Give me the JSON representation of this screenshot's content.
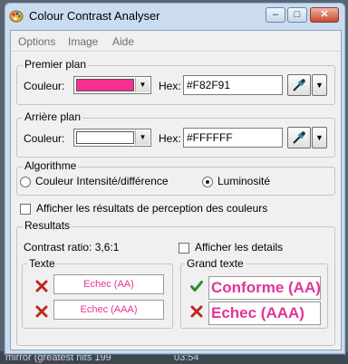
{
  "window": {
    "title": "Colour Contrast Analyser"
  },
  "titlebar_buttons": {
    "minimize": "–",
    "maximize": "□",
    "close": "✕"
  },
  "menu": [
    "Options",
    "Image",
    "Aide"
  ],
  "foreground": {
    "legend": "Premier plan",
    "color_label": "Couleur:",
    "hex_label": "Hex:",
    "hex_value": "#F82F91",
    "swatch_color": "#F82F91"
  },
  "background": {
    "legend": "Arrière plan",
    "color_label": "Couleur:",
    "hex_label": "Hex:",
    "hex_value": "#FFFFFF",
    "swatch_color": "#FFFFFF"
  },
  "algorithm": {
    "legend": "Algorithme",
    "option1": "Couleur Intensité/différence",
    "option2": "Luminosité",
    "selected": "Luminosité"
  },
  "perception_checkbox": "Afficher les résultats de perception des couleurs",
  "results": {
    "legend": "Resultats",
    "contrast_ratio": "Contrast ratio: 3,6:1",
    "details_checkbox": "Afficher les details",
    "text_group": {
      "legend": "Texte",
      "aa": "Echec (AA)",
      "aaa": "Echec (AAA)"
    },
    "large_text_group": {
      "legend": "Grand texte",
      "aa": "Conforme (AA)",
      "aaa": "Echec (AAA)"
    }
  },
  "desktop": {
    "taskbar_text": "mirror (greatest hits 199",
    "time": "03:54"
  },
  "colors": {
    "accent_pink": "#E2349A",
    "pass_green": "#2E8B2E",
    "fail_red": "#C0281C"
  }
}
